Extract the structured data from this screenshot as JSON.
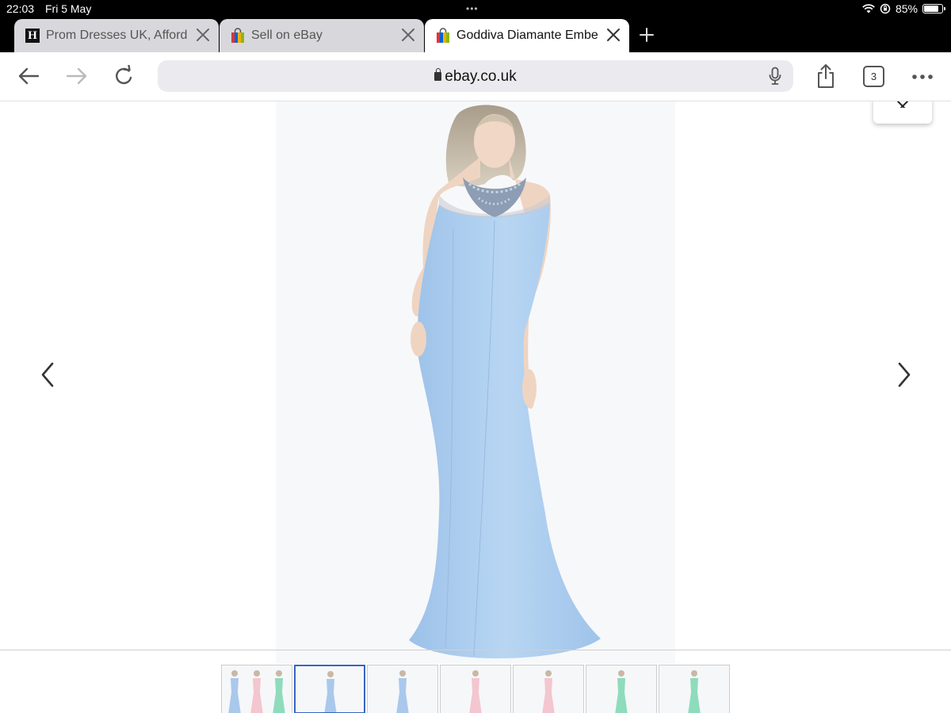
{
  "status": {
    "time": "22:03",
    "date": "Fri 5 May",
    "battery_percent": "85%",
    "battery_level": 0.85,
    "icons": [
      "wifi-icon",
      "orientation-lock-icon",
      "battery-icon"
    ]
  },
  "tabs": [
    {
      "title": "Prom Dresses UK, Afford",
      "favicon": "h-favicon",
      "active": false
    },
    {
      "title": "Sell on eBay",
      "favicon": "ebay-bag-favicon",
      "active": false
    },
    {
      "title": "Goddiva Diamante Embel",
      "favicon": "ebay-bag-favicon",
      "active": true
    }
  ],
  "toolbar": {
    "url": "ebay.co.uk",
    "tab_count": "3",
    "icons": [
      "back-icon",
      "forward-icon",
      "reload-icon",
      "microphone-icon",
      "share-icon",
      "more-icon"
    ]
  },
  "gallery": {
    "main_image": "light blue halter mermaid gown with beaded neckline",
    "selected_index": 1,
    "thumbnails": [
      {
        "colors": [
          "#a9c8ec",
          "#f4c6cf",
          "#8edcbc"
        ]
      },
      {
        "colors": [
          "#a9c8ec"
        ]
      },
      {
        "colors": [
          "#a9c8ec"
        ]
      },
      {
        "colors": [
          "#f4c6cf"
        ]
      },
      {
        "colors": [
          "#f4c6cf"
        ]
      },
      {
        "colors": [
          "#8edcbc"
        ]
      },
      {
        "colors": [
          "#8edcbc"
        ]
      }
    ],
    "dress_color": "#b4d3f0",
    "accent_color": "#3665c3"
  }
}
